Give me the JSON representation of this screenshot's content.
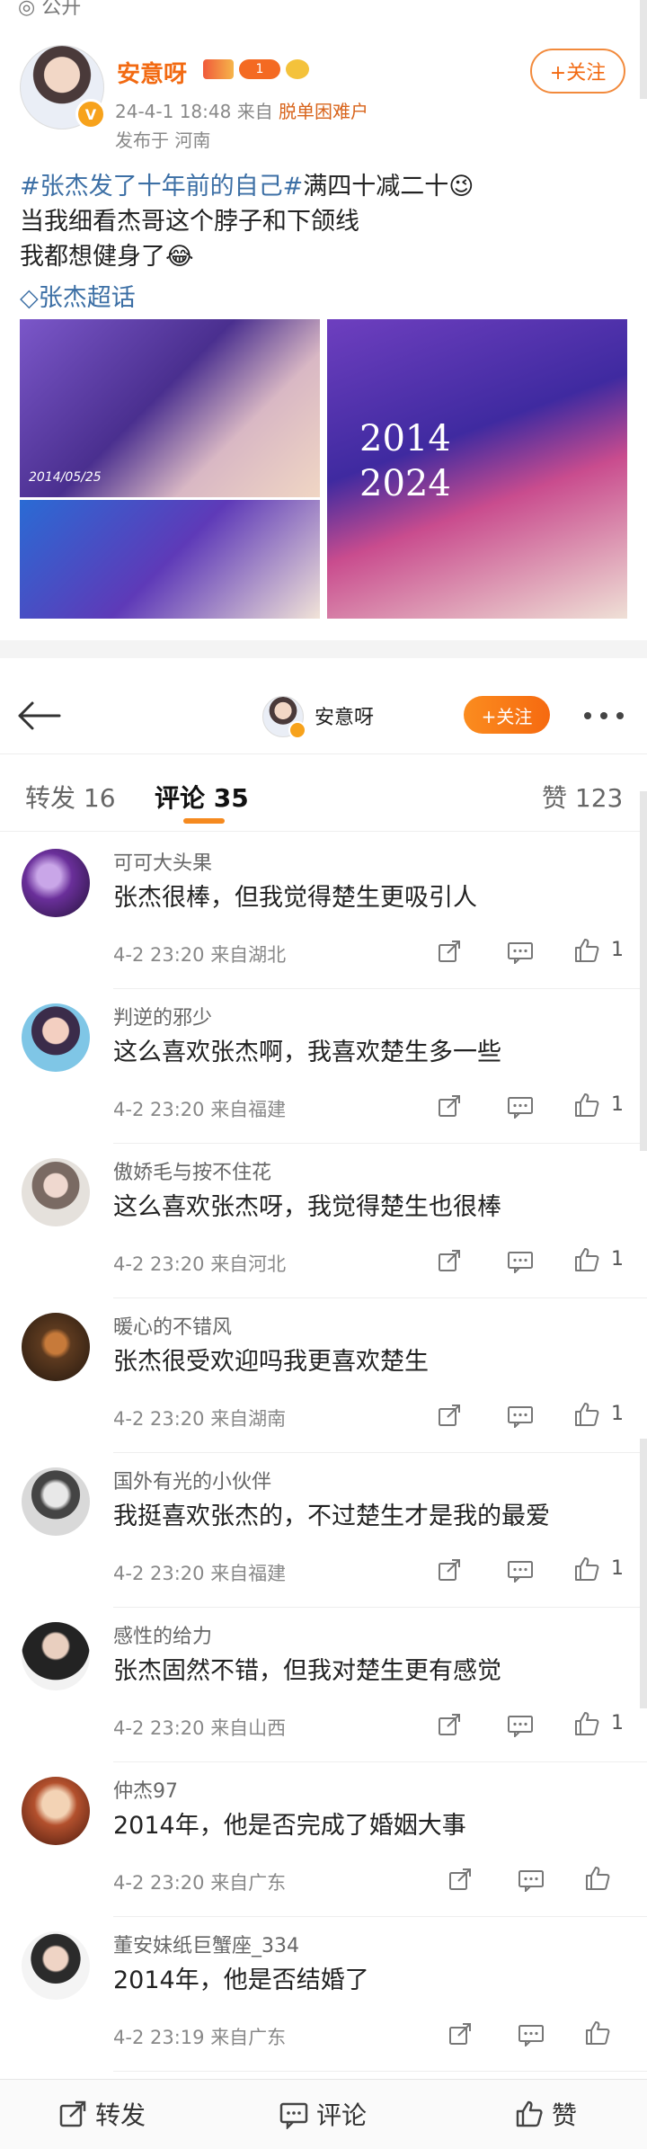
{
  "top_clip": "◎ 公开",
  "post": {
    "author": "安意呀",
    "time": "24-4-1 18:48",
    "source_prefix": "来自",
    "source": "脱单困难户",
    "location": "发布于 河南",
    "follow_label": "+关注",
    "content_tag": "#张杰发了十年前的自己#",
    "content_line1_rest": "满四十减二十😉",
    "content_line2": "当我细看杰哥这个脖子和下颌线",
    "content_line3": "我都想健身了😂",
    "super_topic": "张杰超话",
    "image_stamp": "2014/05/25",
    "image_years": [
      "2014",
      "2024"
    ]
  },
  "nav": {
    "author": "安意呀",
    "follow_label": "+关注"
  },
  "tabs": {
    "repost": "转发 16",
    "comments": "评论 35",
    "likes": "赞 123"
  },
  "comments": [
    {
      "name": "可可大头果",
      "text": "张杰很棒，但我觉得楚生更吸引人",
      "time": "4-2 23:20",
      "location": "来自湖北",
      "likes": "1"
    },
    {
      "name": "判逆的邪少",
      "text": "这么喜欢张杰啊，我喜欢楚生多一些",
      "time": "4-2 23:20",
      "location": "来自福建",
      "likes": "1"
    },
    {
      "name": "傲娇毛与按不住花",
      "text": "这么喜欢张杰呀，我觉得楚生也很棒",
      "time": "4-2 23:20",
      "location": "来自河北",
      "likes": "1"
    },
    {
      "name": "暖心的不错风",
      "text": "张杰很受欢迎吗我更喜欢楚生",
      "time": "4-2 23:20",
      "location": "来自湖南",
      "likes": "1"
    },
    {
      "name": "国外有光的小伙伴",
      "text": "我挺喜欢张杰的，不过楚生才是我的最爱",
      "time": "4-2 23:20",
      "location": "来自福建",
      "likes": "1"
    },
    {
      "name": "感性的给力",
      "text": "张杰固然不错，但我对楚生更有感觉",
      "time": "4-2 23:20",
      "location": "来自山西",
      "likes": "1"
    },
    {
      "name": "仲杰97",
      "text": "2014年，他是否完成了婚姻大事",
      "time": "4-2 23:20",
      "location": "来自广东",
      "likes": ""
    },
    {
      "name": "董安妹纸巨蟹座_334",
      "text": "2014年，他是否结婚了",
      "time": "4-2 23:19",
      "location": "来自广东",
      "likes": ""
    }
  ],
  "bottom_bar": {
    "repost": "转发",
    "comment": "评论",
    "like": "赞"
  },
  "colors": {
    "accent": "#f26a12",
    "link": "#3c6fa5",
    "follow_gradient": "#fb8c1f"
  }
}
